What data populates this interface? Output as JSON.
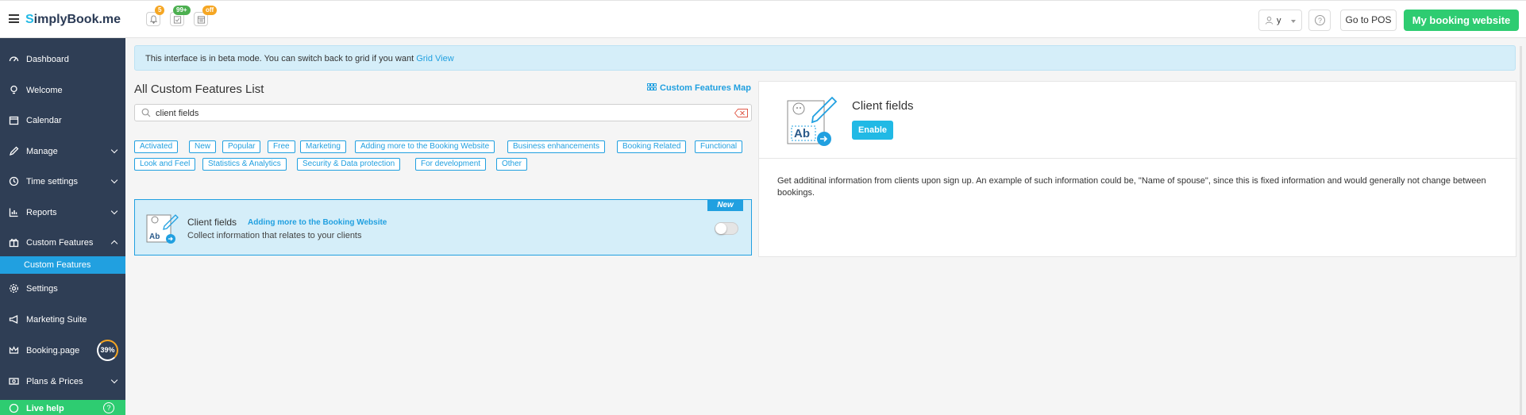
{
  "app": {
    "logo_letter": "S",
    "logo_rest": "implyBook",
    "logo_suffix": ".me"
  },
  "header": {
    "notifications_badge": "5",
    "tasks_badge": "99+",
    "calendar_badge": "off",
    "user_name": "y",
    "help_symbol": "?",
    "pos_label": "Go to POS",
    "booking_site_label": "My booking website"
  },
  "sidebar": {
    "items": [
      {
        "label": "Dashboard",
        "icon": "dashboard-icon"
      },
      {
        "label": "Welcome",
        "icon": "bulb-icon"
      },
      {
        "label": "Calendar",
        "icon": "calendar-icon"
      },
      {
        "label": "Manage",
        "icon": "pencil-icon"
      },
      {
        "label": "Time settings",
        "icon": "clock-icon"
      },
      {
        "label": "Reports",
        "icon": "chart-icon"
      },
      {
        "label": "Custom Features",
        "icon": "gift-icon"
      },
      {
        "label": "Settings",
        "icon": "gear-icon"
      },
      {
        "label": "Marketing Suite",
        "icon": "megaphone-icon"
      },
      {
        "label": "Booking.page",
        "icon": "crown-icon"
      },
      {
        "label": "Plans & Prices",
        "icon": "money-icon"
      }
    ],
    "sub_item": "Custom Features",
    "booking_page_progress": "39%",
    "live_help": "Live help"
  },
  "beta": {
    "text": "This interface is in beta mode. You can switch back to grid if you want",
    "link": "Grid View"
  },
  "list": {
    "title": "All Custom Features List",
    "map_link": "Custom Features Map",
    "search_value": "client fields"
  },
  "tags": [
    "Activated",
    "New",
    "Popular",
    "Free",
    "Marketing",
    "Adding more to the Booking Website",
    "Business enhancements",
    "Booking Related",
    "Functional",
    "Look and Feel",
    "Statistics & Analytics",
    "Security & Data protection",
    "For development",
    "Other"
  ],
  "card": {
    "title": "Client fields",
    "category": "Adding more to the Booking Website",
    "description": "Collect information that relates to your clients",
    "new_label": "New"
  },
  "detail": {
    "title": "Client fields",
    "enable_label": "Enable",
    "description": "Get additinal information from clients upon sign up. An example of such information could be, \"Name of spouse\", since this is fixed information and would generally not change between bookings."
  },
  "colors": {
    "accent": "#21a0e0",
    "sidebar_bg": "#2f3e55",
    "green": "#2ecc71",
    "badge_orange": "#f5a623"
  }
}
